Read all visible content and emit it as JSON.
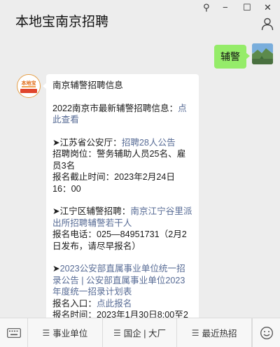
{
  "window": {
    "title": "本地宝南京招聘",
    "pin_glyph": "⚲",
    "minimize_glyph": "−",
    "maximize_glyph": "☐",
    "close_glyph": "✕"
  },
  "chat": {
    "outgoing_text": "辅警",
    "incoming": {
      "avatar_logo_text": "本地宝",
      "lines": {
        "heading": "南京辅警招聘信息",
        "p1_text": "2022南京市最新辅警招聘信息：",
        "p1_link": "点此查看",
        "p2_prefix": "➤江苏省公安厅：",
        "p2_link": "招聘28人公告",
        "p2_post": "招聘岗位：警务辅助人员25名、雇员3名",
        "p2_deadline": "报名截止时间：2023年2月24日16：00",
        "p3_prefix": "➤江宁区辅警招聘：",
        "p3_link": "南京江宁谷里派出所招聘辅警若干人",
        "p3_phone": "报名电话：025—84951731（2月2日发布，请尽早报名）",
        "p4_prefix": "➤",
        "p4_link": "2023公安部直属事业单位统一招录公告 | 公安部直属事业单位2023年度统一招录计划表",
        "p4_entry_label": "报名入口：",
        "p4_entry_link": "点此报名",
        "p4_time": "报名时间：2023年1月30日8:00至2"
      }
    }
  },
  "bottom_menu": {
    "items": [
      {
        "label": "事业单位"
      },
      {
        "label": "国企 | 大厂"
      },
      {
        "label": "最近热招"
      }
    ],
    "hamburger_glyph": "☰"
  }
}
